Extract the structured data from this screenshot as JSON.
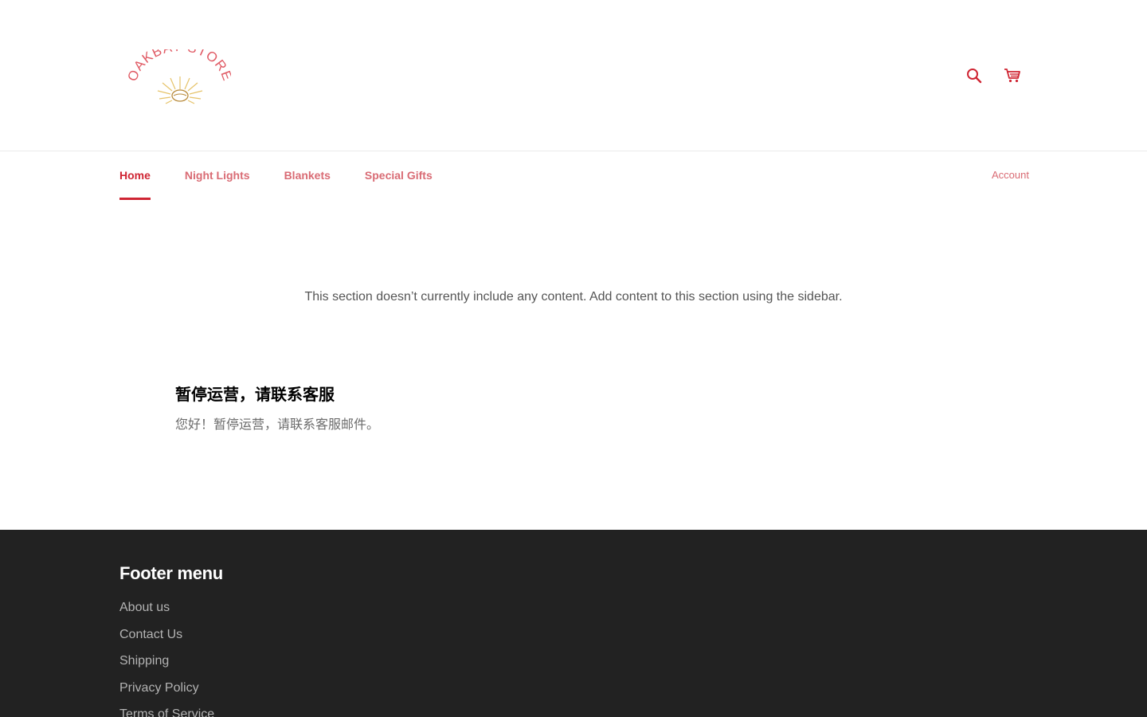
{
  "header": {
    "logo_text": "OAKBAY STORE",
    "icons": {
      "search": "search-icon",
      "cart": "cart-icon"
    }
  },
  "nav": {
    "items": [
      {
        "label": "Home",
        "active": true
      },
      {
        "label": "Night Lights",
        "active": false
      },
      {
        "label": "Blankets",
        "active": false
      },
      {
        "label": "Special Gifts",
        "active": false
      }
    ],
    "account_label": "Account"
  },
  "main": {
    "placeholder_text": "This section doesn’t currently include any content. Add content to this section using the sidebar.",
    "notice": {
      "title": "暂停运营，请联系客服",
      "body": "您好！暂停运营，请联系客服邮件。"
    }
  },
  "footer": {
    "title": "Footer menu",
    "links": [
      "About us",
      "Contact Us",
      "Shipping",
      "Privacy Policy",
      "Terms of Service"
    ]
  },
  "colors": {
    "accent": "#cf2533",
    "nav_link": "#d96b74",
    "footer_bg": "#222222",
    "logo_gold": "#e6c36a"
  }
}
